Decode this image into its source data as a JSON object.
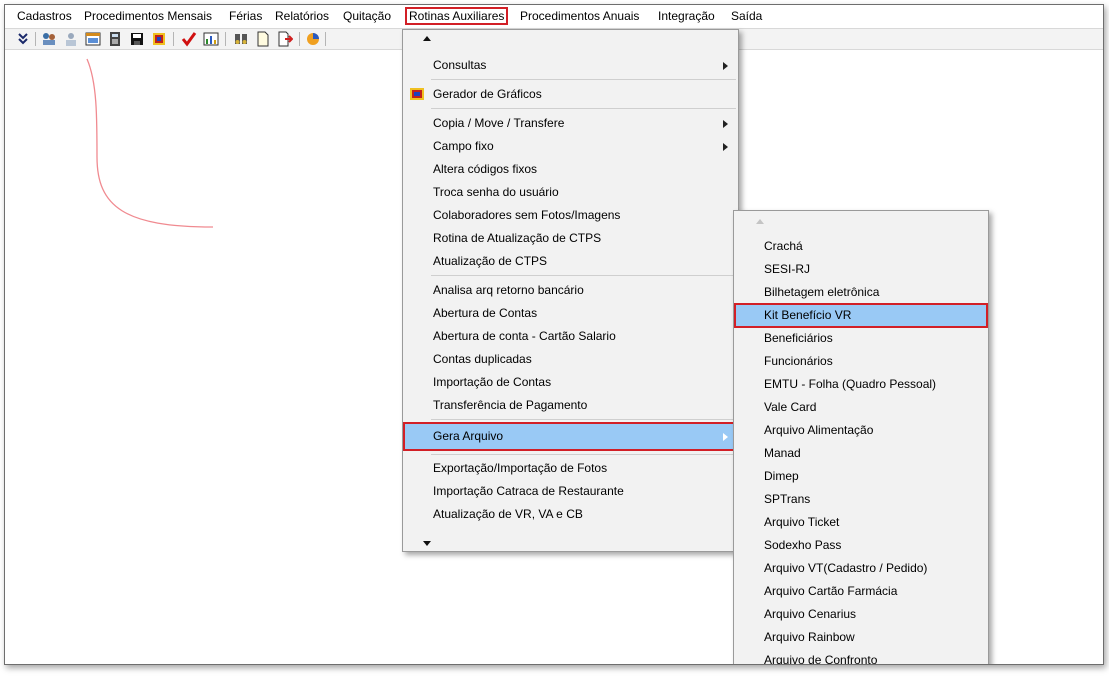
{
  "menubar": [
    "Cadastros",
    "Procedimentos Mensais",
    "Férias",
    "Relatórios",
    "Quitação",
    "Rotinas Auxiliares",
    "Procedimentos Anuais",
    "Integração",
    "Saída"
  ],
  "toolbar_icons": [
    "collapse-icon",
    "users-icon",
    "person-icon",
    "window-icon",
    "calculator-icon",
    "save-icon",
    "gradient-icon",
    "checkmark-icon",
    "chart-icon",
    "binoculars-icon",
    "document-icon",
    "export-icon",
    "pie-chart-icon"
  ],
  "main_menu": {
    "items": [
      {
        "label": "Consultas",
        "submenu": true
      },
      {
        "label": "Gerador de Gráficos",
        "submenu": false
      },
      {
        "label": "Copia / Move / Transfere",
        "submenu": true
      },
      {
        "label": "Campo fixo",
        "submenu": true
      },
      {
        "label": "Altera códigos fixos",
        "submenu": false
      },
      {
        "label": "Troca senha do usuário",
        "submenu": false
      },
      {
        "label": "Colaboradores sem Fotos/Imagens",
        "submenu": false
      },
      {
        "label": "Rotina de Atualização de CTPS",
        "submenu": false
      },
      {
        "label": "Atualização de CTPS",
        "submenu": false
      },
      {
        "label": "Analisa arq retorno bancário",
        "submenu": false
      },
      {
        "label": "Abertura de Contas",
        "submenu": false
      },
      {
        "label": "Abertura de conta - Cartão Salario",
        "submenu": false
      },
      {
        "label": "Contas duplicadas",
        "submenu": false
      },
      {
        "label": "Importação de Contas",
        "submenu": false
      },
      {
        "label": "Transferência de Pagamento",
        "submenu": false
      },
      {
        "label": "Gera Arquivo",
        "submenu": true
      },
      {
        "label": "Exportação/Importação de Fotos",
        "submenu": false
      },
      {
        "label": "Importação Catraca de Restaurante",
        "submenu": false
      },
      {
        "label": "Atualização de VR, VA e CB",
        "submenu": false
      }
    ]
  },
  "sub_menu": {
    "items": [
      "Crachá",
      "SESI-RJ",
      "Bilhetagem eletrônica",
      "Kit Benefício VR",
      "Beneficiários",
      "Funcionários",
      "EMTU - Folha (Quadro Pessoal)",
      "Vale Card",
      "Arquivo Alimentação",
      "Manad",
      "Dimep",
      "SPTrans",
      "Arquivo Ticket",
      "Sodexho Pass",
      "Arquivo VT(Cadastro / Pedido)",
      "Arquivo Cartão Farmácia",
      "Arquivo Cenarius",
      "Arquivo Rainbow",
      "Arquivo de Confronto"
    ]
  },
  "colors": {
    "highlight": "#99c9f5",
    "annotation": "#d21f26",
    "menu_bg": "#f2f2f2"
  }
}
